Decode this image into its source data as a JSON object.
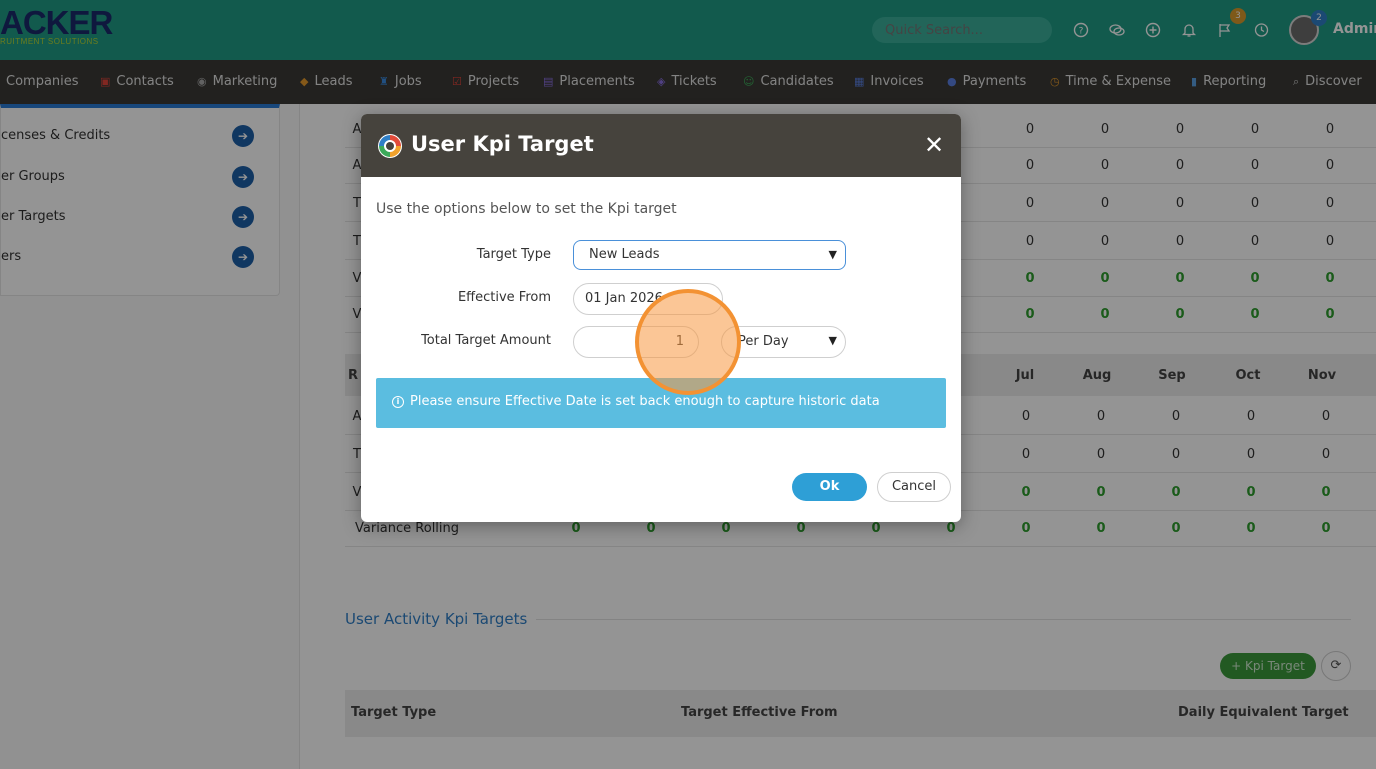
{
  "header": {
    "logo_text": "ACKER",
    "logo_sub": "RUITMENT SOLUTIONS",
    "search_placeholder": "Quick Search...",
    "flag_badge": "3",
    "avatar_badge": "2",
    "user_name": "Admin",
    "accent_color": "#1f9c86"
  },
  "nav": [
    {
      "label": "Companies",
      "icon": "building-icon"
    },
    {
      "label": "Contacts",
      "icon": "address-book-icon"
    },
    {
      "label": "Marketing",
      "icon": "broadcast-icon"
    },
    {
      "label": "Leads",
      "icon": "diamond-icon"
    },
    {
      "label": "Jobs",
      "icon": "trophy-icon"
    },
    {
      "label": "Projects",
      "icon": "checklist-icon"
    },
    {
      "label": "Placements",
      "icon": "briefcase-icon"
    },
    {
      "label": "Tickets",
      "icon": "ticket-icon"
    },
    {
      "label": "Candidates",
      "icon": "person-icon"
    },
    {
      "label": "Invoices",
      "icon": "invoice-icon"
    },
    {
      "label": "Payments",
      "icon": "coins-icon"
    },
    {
      "label": "Time & Expense",
      "icon": "clock-icon"
    },
    {
      "label": "Reporting",
      "icon": "bar-chart-icon"
    },
    {
      "label": "Discover",
      "icon": "search-icon"
    }
  ],
  "sidebar": {
    "items": [
      {
        "label": "censes & Credits"
      },
      {
        "label": "er Groups"
      },
      {
        "label": "er Targets"
      },
      {
        "label": "ers"
      }
    ]
  },
  "table1": {
    "row_stubs": [
      "A",
      "A",
      "T",
      "T",
      "V",
      "V"
    ],
    "rows": [
      [
        "0",
        "0",
        "0",
        "0",
        "0"
      ],
      [
        "0",
        "0",
        "0",
        "0",
        "0"
      ],
      [
        "0",
        "0",
        "0",
        "0",
        "0"
      ],
      [
        "0",
        "0",
        "0",
        "0",
        "0"
      ],
      [
        "0",
        "0",
        "0",
        "0",
        "0"
      ],
      [
        "0",
        "0",
        "0",
        "0",
        "0"
      ]
    ]
  },
  "table2": {
    "header_stub": "R",
    "months": [
      "Jul",
      "Aug",
      "Sep",
      "Oct",
      "Nov"
    ],
    "row_stubs": [
      "A",
      "T",
      "V"
    ],
    "rows": [
      [
        "0",
        "0",
        "0",
        "0",
        "0"
      ],
      [
        "0",
        "0",
        "0",
        "0",
        "0"
      ],
      [
        "0",
        "0",
        "0",
        "0",
        "0"
      ]
    ],
    "variance_label": "Variance Rolling",
    "variance_values": [
      "0",
      "0",
      "0",
      "0",
      "0",
      "0",
      "0",
      "0",
      "0",
      "0",
      "0"
    ]
  },
  "activity": {
    "title": "User Activity Kpi Targets",
    "add_button": "+ Kpi Target",
    "columns": [
      "Target Type",
      "Target Effective From",
      "Daily Equivalent Target"
    ]
  },
  "modal": {
    "title": "User Kpi Target",
    "intro": "Use the options below to set the Kpi target",
    "target_type_label": "Target Type",
    "target_type_value": "New Leads",
    "effective_from_label": "Effective From",
    "effective_from_value": "01 Jan 2026",
    "total_target_label": "Total Target Amount",
    "total_target_value": "1",
    "period_value": "Per Day",
    "alert": "Please ensure Effective Date is set back enough to capture historic data",
    "ok_label": "Ok",
    "cancel_label": "Cancel"
  }
}
